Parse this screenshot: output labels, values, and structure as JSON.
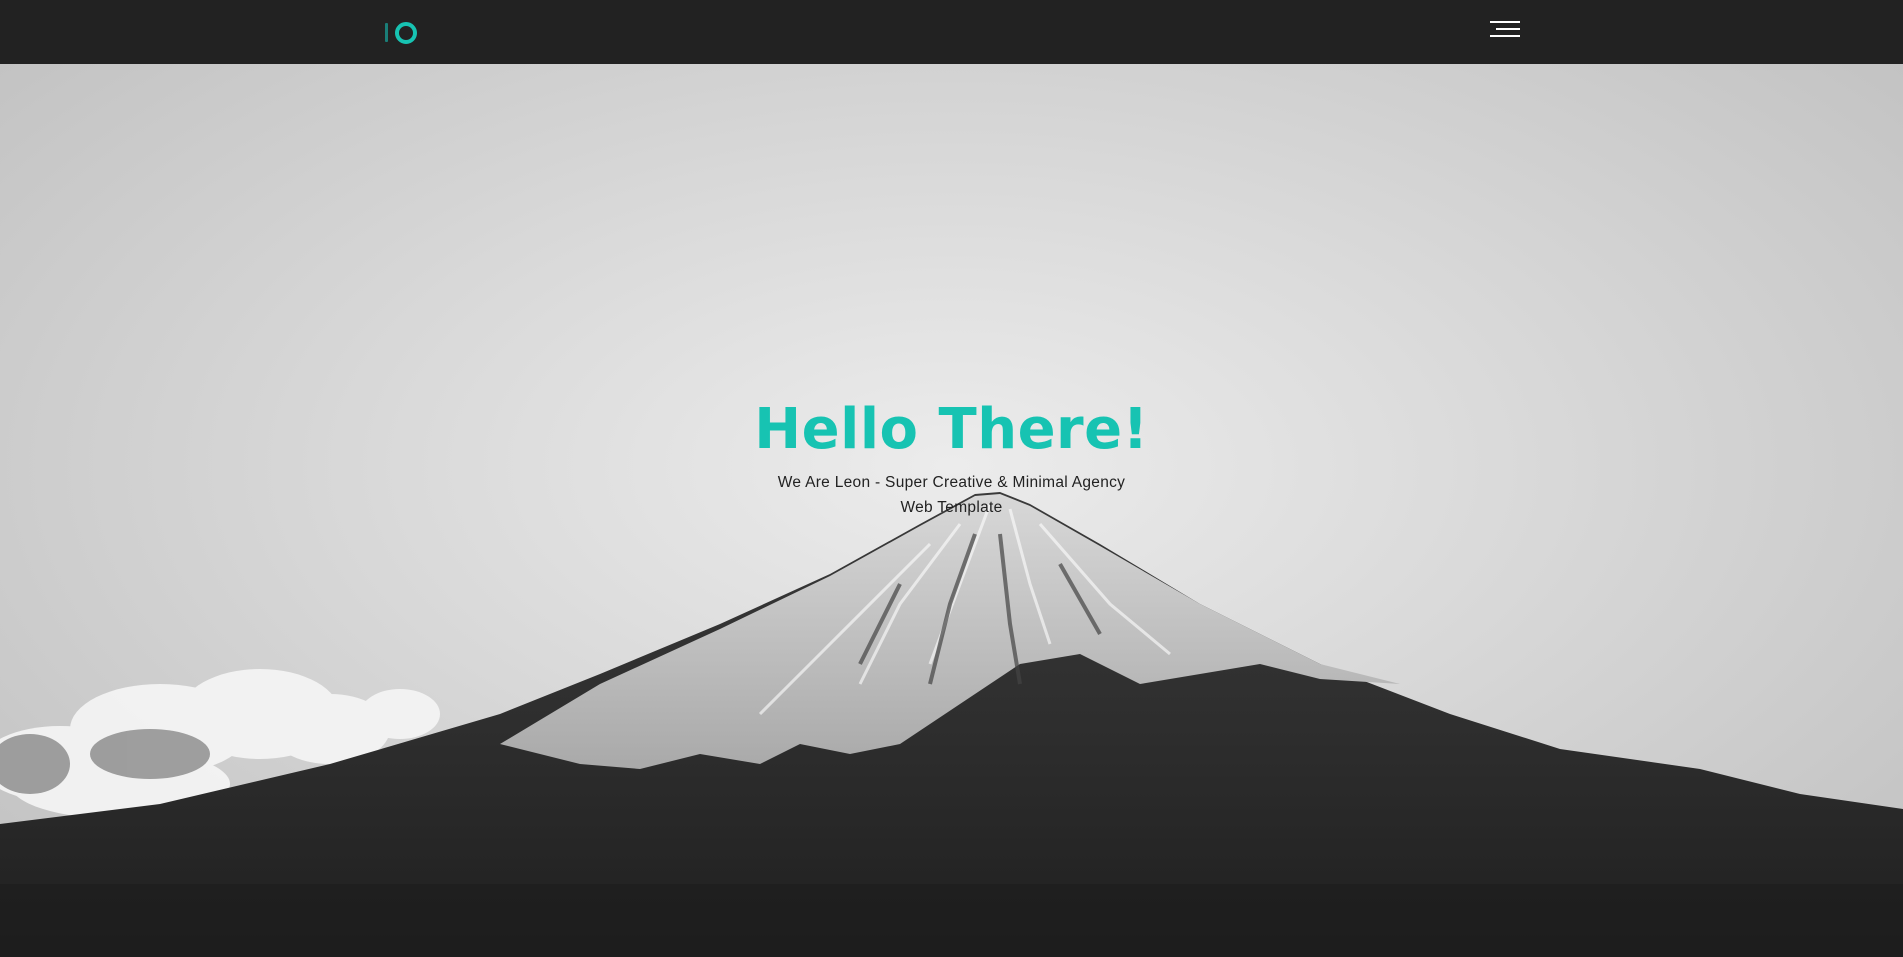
{
  "colors": {
    "accent": "#17c3b2",
    "accent_dark": "#1a7e78",
    "navbar_bg": "#222222",
    "menu_line": "#ffffff"
  },
  "header": {
    "logo_icon": "leon-logo-icon",
    "menu_icon": "hamburger-menu-icon"
  },
  "hero": {
    "title": "Hello There!",
    "subtitle": "We Are Leon - Super Creative & Minimal Agency Web Template",
    "background": "mountain-landscape-image"
  }
}
